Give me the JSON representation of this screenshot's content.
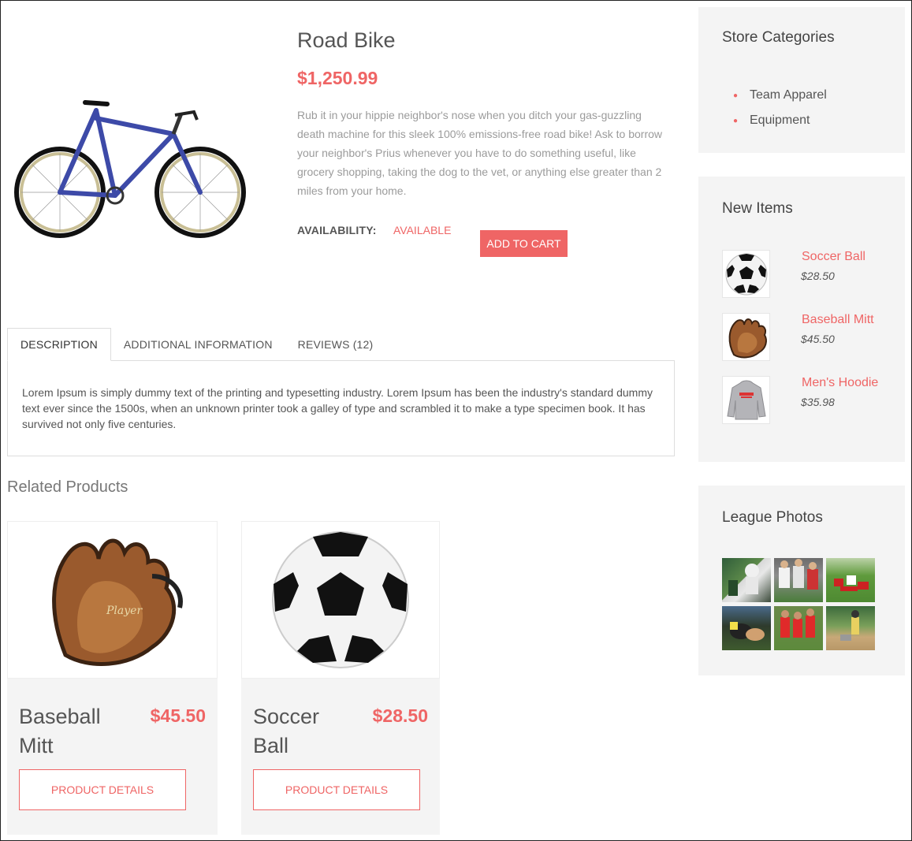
{
  "product": {
    "title": "Road Bike",
    "price": "$1,250.99",
    "description": "Rub it in your hippie neighbor's nose when you ditch your gas-guzzling death machine for this sleek 100% emissions-free road bike! Ask to borrow your neighbor's Prius whenever you have to do something useful, like grocery shopping, taking the dog to the vet, or anything else greater than 2 miles from your home.",
    "availability_label": "AVAILABILITY:",
    "availability_value": "AVAILABLE",
    "add_to_cart": "ADD TO CART"
  },
  "tabs": {
    "items": [
      "DESCRIPTION",
      "ADDITIONAL INFORMATION",
      "REVIEWS (12)"
    ],
    "active": "DESCRIPTION",
    "content": "Lorem Ipsum is simply dummy text of the printing and typesetting industry. Lorem Ipsum has been the industry's standard dummy text ever since the 1500s, when an unknown printer took a galley of type and scrambled it to make a type specimen book. It has survived not only five centuries."
  },
  "related": {
    "title": "Related Products",
    "items": [
      {
        "name": "Baseball Mitt",
        "price": "$45.50",
        "button": "PRODUCT DETAILS",
        "icon": "baseball-mitt-image"
      },
      {
        "name": "Soccer Ball",
        "price": "$28.50",
        "button": "PRODUCT DETAILS",
        "icon": "soccer-ball-image"
      }
    ]
  },
  "sidebar": {
    "categories": {
      "title": "Store Categories",
      "items": [
        "Team Apparel",
        "Equipment"
      ]
    },
    "new_items": {
      "title": "New Items",
      "items": [
        {
          "name": "Soccer Ball",
          "price": "$28.50"
        },
        {
          "name": "Baseball Mitt",
          "price": "$45.50"
        },
        {
          "name": "Men's Hoodie",
          "price": "$35.98"
        }
      ]
    },
    "photos": {
      "title": "League Photos",
      "count": 6
    }
  },
  "colors": {
    "accent": "#ef6565",
    "panel": "#f4f4f4"
  }
}
